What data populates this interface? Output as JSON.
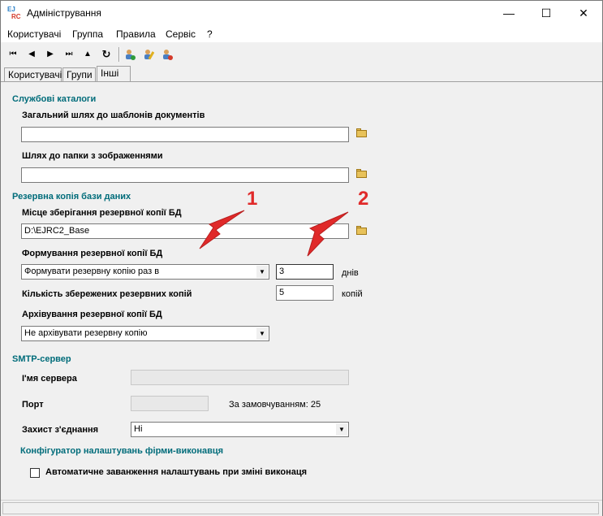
{
  "window": {
    "title": "Адміністрування",
    "logo_text": [
      "EJ",
      "RC",
      ""
    ]
  },
  "window_controls": {
    "minimize": "—",
    "maximize": "☐",
    "close": "✕"
  },
  "menu": [
    "Користувачі",
    "Группа",
    "Правила",
    "Сервіс",
    "?"
  ],
  "toolbar": {
    "icons": [
      "first-icon",
      "prev-icon",
      "next-icon",
      "last-icon",
      "up-icon",
      "refresh-icon",
      "add-user-icon",
      "edit-user-icon",
      "delete-user-icon"
    ]
  },
  "tabs": [
    "Користувачі",
    "Групи",
    "Інші"
  ],
  "active_tab": "Інші",
  "service_catalogs": {
    "heading": "Службові каталоги",
    "templates_label": "Загальний шлях до шаблонів документів",
    "templates_value": "",
    "images_label": "Шлях до папки з зображеннями",
    "images_value": ""
  },
  "backup": {
    "heading": "Резервна копія бази даних",
    "location_label": "Місце зберігання резервної копії БД",
    "location_value": "D:\\EJRC2_Base",
    "formation_label": "Формування резервної копії БД",
    "formation_value": "Формувати резервну копію раз в",
    "days_value": "3",
    "days_unit": "днів",
    "count_label": "Кількість збережених резервних копій",
    "count_value": "5",
    "count_unit": "копій",
    "archive_label": "Архівування резервної копії БД",
    "archive_value": "Не архівувати резервну копію"
  },
  "smtp": {
    "heading": "SMTP-сервер",
    "server_label": "І'мя сервера",
    "server_value": "",
    "port_label": "Порт",
    "port_value": "",
    "port_default": "За замовчуванням: 25",
    "security_label": "Захист з'єднання",
    "security_value": "Ні"
  },
  "configurator": {
    "heading": "Конфігуратор налаштувань фірми-виконавця",
    "auto_load_label": "Автоматичне заванження налаштувань при зміні виконаця",
    "auto_load_checked": false
  },
  "annotations": [
    "1",
    "2"
  ],
  "colors": {
    "section_heading": "#006c7a",
    "annotation": "#e02a2a"
  }
}
